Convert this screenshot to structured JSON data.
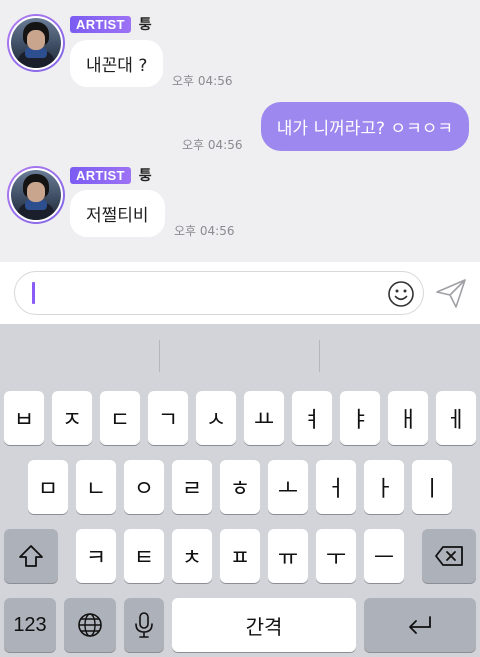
{
  "messages": [
    {
      "badge": "ARTIST",
      "sender": "퉁",
      "text": "내꼰대 ?",
      "time": "오후 04:56"
    },
    {
      "text": "내가 니꺼라고? ㅇㅋㅇㅋ",
      "time": "오후 04:56"
    },
    {
      "badge": "ARTIST",
      "sender": "퉁",
      "text": "저쩔티비",
      "time": "오후 04:56"
    }
  ],
  "composer": {
    "text": "",
    "emoji_icon": "smiley-icon",
    "send_icon": "paper-plane-icon"
  },
  "keyboard": {
    "row1": [
      "ㅂ",
      "ㅈ",
      "ㄷ",
      "ㄱ",
      "ㅅ",
      "ㅛ",
      "ㅕ",
      "ㅑ",
      "ㅐ",
      "ㅔ"
    ],
    "row2": [
      "ㅁ",
      "ㄴ",
      "ㅇ",
      "ㄹ",
      "ㅎ",
      "ㅗ",
      "ㅓ",
      "ㅏ",
      "ㅣ"
    ],
    "row3": [
      "ㅋ",
      "ㅌ",
      "ㅊ",
      "ㅍ",
      "ㅠ",
      "ㅜ",
      "ㅡ"
    ],
    "numbers_label": "123",
    "space_label": "간격",
    "shift_icon": "shift-arrow-icon",
    "delete_icon": "backspace-icon",
    "globe_icon": "globe-icon",
    "mic_icon": "microphone-icon",
    "return_icon": "return-arrow-icon"
  }
}
